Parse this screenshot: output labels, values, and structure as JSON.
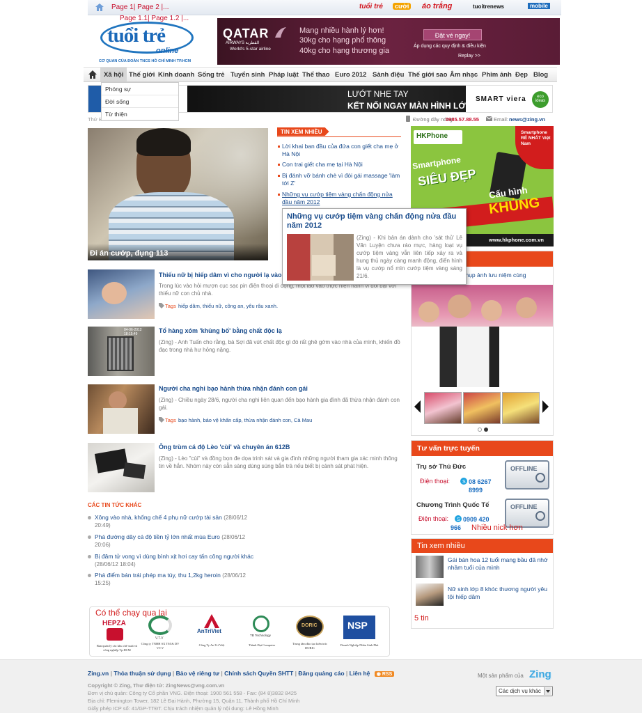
{
  "top": {
    "page_links": "Page 1| Page 2 |...",
    "page_links2": "Page 1.1| Page 1.2 |...",
    "partners": [
      "tuổi trẻ",
      "cười",
      "áo trắng",
      "tuoitrenews",
      "mobile"
    ]
  },
  "logo": {
    "main": "tuổi trẻ",
    "sub": "online",
    "tagline": "CƠ QUAN CỦA ĐOÀN TNCS HỒ CHÍ MINH TP.HCM"
  },
  "ad_qatar": {
    "brand": "QATAR",
    "brand_sub": "AIRWAYS القطرية",
    "slogan": "World's 5-star airline",
    "line1": "Mang nhiều hành lý hơn!",
    "line2": "30kg cho hạng phổ thông",
    "line3": "40kg cho hạng thương gia",
    "cta": "Đặt vé ngay!",
    "note": "Áp dụng các quy định & điều kiện",
    "replay": "Replay >>"
  },
  "nav": {
    "items": [
      "Xã hội",
      "Thế giới",
      "Kinh doanh",
      "Sống trẻ",
      "Tuyển sinh",
      "Pháp luật",
      "Thể thao",
      "Euro 2012",
      "Sành điệu",
      "Thế giới sao",
      "Âm nhạc",
      "Phim ảnh",
      "Đẹp",
      "Blog"
    ],
    "dropdown": [
      "Phóng sự",
      "Đời sống",
      "Từ thiện"
    ]
  },
  "banner": {
    "text1": "LƯỚT NHẸ TAY",
    "text2": "KẾT NỐI NGAY MÀN HÌNH LỚN",
    "brand": "SMART viera",
    "eco": "eco ideas"
  },
  "info": {
    "date": "Thứ B...",
    "hotline_label": "Đường dây nóng:",
    "hotline": "0985.57.88.55",
    "email_label": "Email:",
    "email": "news@zing.vn"
  },
  "headline": {
    "caption": "Đi án cướp, đụng 113"
  },
  "most_read": {
    "label": "TIN XEM NHIỀU",
    "items": [
      "Lời khai ban đầu của đứa con giết cha mẹ ở Hà Nội",
      "Con trai giết cha mẹ tại Hà Nội",
      "Bị đánh vỡ bánh chè vì đòi gái massage 'làm tới Z'",
      "Những vụ cướp tiệm vàng chấn động nửa đầu năm 2012"
    ]
  },
  "tooltip": {
    "title": "Những vụ cướp tiệm vàng chấn động nửa đầu năm 2012",
    "text": "(Zing) - Khi bản án dành cho 'sát thủ' Lê Văn Luyện chưa ráo mực, hàng loạt vụ cướp tiệm vàng vẫn liên tiếp xảy ra và hung thủ ngày càng manh động, điển hình là vụ cướp nổ mìn cướp tiệm vàng sáng 21/6."
  },
  "articles": [
    {
      "title": "Thiếu nữ bị hiếp dâm vì cho người lạ vào nhà",
      "summary": "Trong lúc vào hỏi mượn cục sạc pin điện thoại di động, một lao vào thực hiện hành vi đồi bại với thiếu nữ con chủ nhà.",
      "tags_label": "Tags",
      "tags": "hiếp dâm, thiếu nữ, công an, yêu râu xanh."
    },
    {
      "title": "Tổ hàng xóm 'khủng bố' bằng chất độc lạ",
      "summary": "(Zing) - Anh Tuấn cho rằng, bà Sợi đã vứt chất độc gì đó rất ghê gớm vào nhà của mình, khiến đồ đạc trong nhà hư hỏng nặng.",
      "tags_label": "",
      "tags": ""
    },
    {
      "title": "Người cha nghi bạo hành thừa nhận đánh con gái",
      "summary": "(Zing) - Chiều ngày 28/6, người cha nghi liên quan đến bạo hành gia đình đã thừa nhận đánh con gái.",
      "tags_label": "Tags",
      "tags": "bạo hành, bảo vệ khẩn cấp, thừa nhận đánh con, Cà Mau"
    },
    {
      "title": "Ông trùm cá độ Lèo 'cùi' và chuyên án 612B",
      "summary": "(Zing) - Lèo \"cùi\" và đồng bọn đe dọa trinh sát và gia đình những người tham gia xác minh thông tin về hắn. Nhóm này còn sẵn sàng dùng súng bắn trả nếu biết bị cảnh sát phát hiện.",
      "tags_label": "",
      "tags": ""
    }
  ],
  "other_news": {
    "label": "CÁC TIN TỨC KHÁC",
    "items": [
      {
        "title": "Xông vào nhà, khống chế 4 phụ nữ cướp tài sản",
        "time": "(28/06/12 20:49)"
      },
      {
        "title": "Phá đường dây cá độ tiền tỷ lớn nhất mùa Euro",
        "time": "(28/06/12 20:06)"
      },
      {
        "title": "Bị đâm tử vong vì dùng bình xịt hơi cay tấn công người khác",
        "time": "(28/06/12 18:04)"
      },
      {
        "title": "Phá điểm bán trái phép ma túy, thu 1,2kg heroin",
        "time": "(28/06/12 15:25)"
      }
    ]
  },
  "sponsors": {
    "note": "Có thể chạy qua lại",
    "items": [
      "Ban quản lý các khu chế xuất và công nghiệp Tp.HCM",
      "Công ty TNHH SX TM & DV V.T.V",
      "Công Ty An Trí Việt",
      "Thành Đạt Computer",
      "Trung tâm đào tạo kiến trúc DORIC",
      "Doanh Nghiệp Nhân Sinh Phú"
    ],
    "logos": [
      "HEPZA",
      "V.T.V",
      "AnTriViet",
      "TĐ Technology",
      "DORIC",
      "NSP"
    ]
  },
  "ad_hk": {
    "brand": "HKPhone",
    "t1": "Smartphone",
    "t2": "SIÊU ĐẸP",
    "t3": "Cấu hình",
    "t4": "KHỦNG",
    "badge": "Smartphone RẺ NHẤT Việt Nam",
    "url": "www.hkphone.com.vn"
  },
  "gallery": {
    "caption": "Ce chụp ảnh lưu niệm cùng"
  },
  "support": {
    "title": "Tư vấn trực tuyến",
    "office1": "Trụ sở Thủ Đức",
    "phone_label": "Điện thoại:",
    "phone1": "08 6267 8999",
    "office2": "Chương Trình Quốc Tế",
    "phone2": "0909 420 966",
    "status": "OFFLINE",
    "note": "Nhiều nick hơn"
  },
  "most_read2": {
    "title": "Tin xem nhiều",
    "items": [
      "Gái bán hoa 12 tuổi mang bầu đã nhớ nhầm tuổi của mình",
      "Nữ sinh lớp 8 khóc thương người yêu tội hiếp dâm"
    ],
    "note": "5 tin"
  },
  "footer": {
    "links": [
      "Zing.vn",
      "Thỏa thuận sử dụng",
      "Bảo vệ riêng tư",
      "Chính sách Quyền SHTT",
      "Đăng quảng cáo",
      "Liên hệ"
    ],
    "rss": "RSS",
    "copyright": "Copyright © Zing, Thư điện tử: ZingNews@vng.com.vn",
    "line2": "Đơn vị chủ quản: Công ty Cổ phần VNG. Điện thoại: 1900 561 558 - Fax: (84 8)3832 8425",
    "line3": "Địa chỉ: Flemington Tower, 182 Lê Đại Hành, Phường 15, Quận 11, Thành phố Hồ Chí Minh",
    "line4": "Giấy phép ICP số: 41/GP-TTĐT. Chịu trách nhiệm quản lý nội dung: Lê Hồng Minh",
    "product_label": "Một sản phẩm của",
    "product": "Zing",
    "select": "Các dịch vụ khác"
  },
  "colors": {
    "accent": "#e8481b",
    "link": "#1a4c8c",
    "red": "#c8102e"
  }
}
